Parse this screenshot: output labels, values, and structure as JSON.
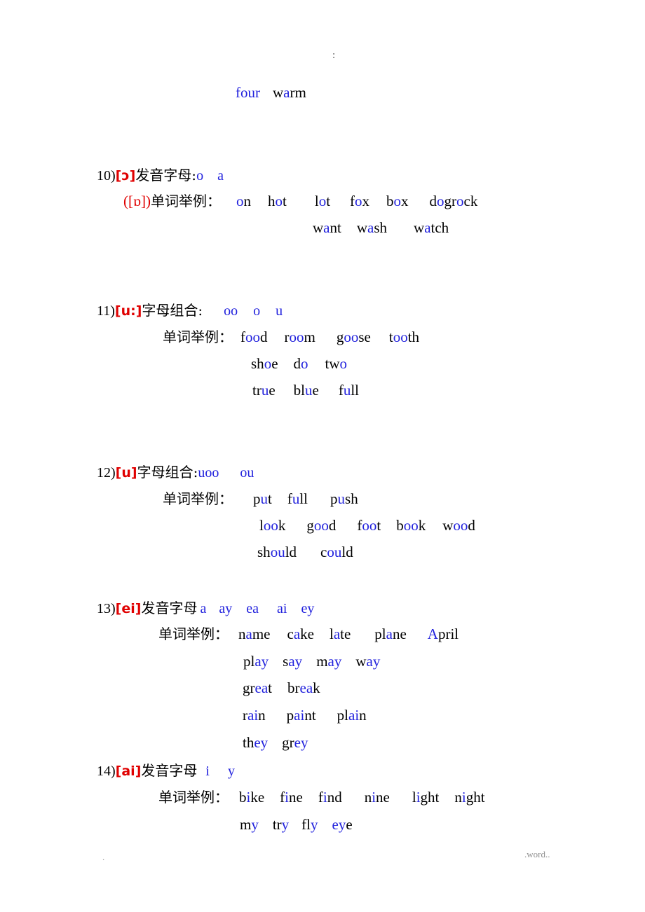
{
  "document": {
    "type": "english-phonetics-study-notes",
    "language": "zh-CN",
    "stray_mark": ":",
    "footer_left": ".",
    "footer_right": ".word..",
    "colors": {
      "ipa_red": "#e00000",
      "letter_blue": "#2222dd",
      "body_black": "#000000",
      "footer_gray": "#9a9a9a",
      "background": "#ffffff"
    },
    "labels": {
      "pronunciation_letter": "发音字母",
      "letter_combination": "字母组合",
      "word_examples": "单词举例"
    }
  },
  "continuation": {
    "words": [
      {
        "pre": "f",
        "hl": "ou",
        "post": "r",
        "all_blue": true
      },
      {
        "pre": "w",
        "hl": "a",
        "post": "rm",
        "all_blue": false
      }
    ]
  },
  "sections": [
    {
      "number": "10)",
      "ipa": "[ɔ]",
      "label": "发音字母:",
      "letters": [
        "o",
        "a"
      ],
      "sub_ipa": "([ɒ])",
      "examples_label": "单词举例：",
      "rows": [
        {
          "words": [
            {
              "pre": "",
              "hl": "o",
              "post": "n"
            },
            {
              "pre": "h",
              "hl": "o",
              "post": "t"
            },
            {
              "pre": "l",
              "hl": "o",
              "post": "t"
            },
            {
              "pre": "f",
              "hl": "o",
              "post": "x"
            },
            {
              "pre": "b",
              "hl": "o",
              "post": "x"
            },
            {
              "pre": "d",
              "hl": "o",
              "post": "g"
            },
            {
              "pre": "r",
              "hl": "o",
              "post": "ck"
            }
          ]
        },
        {
          "words": [
            {
              "pre": "w",
              "hl": "a",
              "post": "nt"
            },
            {
              "pre": "w",
              "hl": "a",
              "post": "sh"
            },
            {
              "pre": "w",
              "hl": "a",
              "post": "tch"
            }
          ]
        }
      ]
    },
    {
      "number": "11)",
      "ipa": "[u:]",
      "label": "字母组合:",
      "letters": [
        "oo",
        "o",
        "u"
      ],
      "examples_label": "单词举例：",
      "rows": [
        {
          "words": [
            {
              "pre": "f",
              "hl": "oo",
              "post": "d"
            },
            {
              "pre": "r",
              "hl": "oo",
              "post": "m"
            },
            {
              "pre": "g",
              "hl": "oo",
              "post": "se"
            },
            {
              "pre": "t",
              "hl": "oo",
              "post": "th"
            }
          ]
        },
        {
          "words": [
            {
              "pre": "sh",
              "hl": "o",
              "post": "e"
            },
            {
              "pre": "d",
              "hl": "o",
              "post": ""
            },
            {
              "pre": "tw",
              "hl": "o",
              "post": ""
            }
          ]
        },
        {
          "words": [
            {
              "pre": "tr",
              "hl": "u",
              "post": "e"
            },
            {
              "pre": "bl",
              "hl": "u",
              "post": "e"
            },
            {
              "pre": "f",
              "hl": "u",
              "post": "ll"
            }
          ]
        }
      ]
    },
    {
      "number": "12)",
      "ipa": "[u]",
      "label": "字母组合:",
      "letters": [
        "uoo",
        "ou"
      ],
      "examples_label": "单词举例：",
      "rows": [
        {
          "words": [
            {
              "pre": "p",
              "hl": "u",
              "post": "t"
            },
            {
              "pre": "f",
              "hl": "u",
              "post": "ll"
            },
            {
              "pre": "p",
              "hl": "u",
              "post": "sh"
            }
          ]
        },
        {
          "words": [
            {
              "pre": "l",
              "hl": "oo",
              "post": "k"
            },
            {
              "pre": "g",
              "hl": "oo",
              "post": "d"
            },
            {
              "pre": "f",
              "hl": "oo",
              "post": "t"
            },
            {
              "pre": "b",
              "hl": "oo",
              "post": "k"
            },
            {
              "pre": "w",
              "hl": "oo",
              "post": "d"
            }
          ]
        },
        {
          "words": [
            {
              "pre": "sh",
              "hl": "ou",
              "post": "ld"
            },
            {
              "pre": "c",
              "hl": "ou",
              "post": "ld"
            }
          ]
        }
      ]
    },
    {
      "number": "13)",
      "ipa": "[ei]",
      "label": "发音字母",
      "letters": [
        "a",
        "ay",
        "ea",
        "ai",
        "ey"
      ],
      "examples_label": "单词举例：",
      "rows": [
        {
          "words": [
            {
              "pre": "n",
              "hl": "a",
              "post": "me"
            },
            {
              "pre": "c",
              "hl": "a",
              "post": "ke"
            },
            {
              "pre": "l",
              "hl": "a",
              "post": "te"
            },
            {
              "pre": "pl",
              "hl": "a",
              "post": "ne"
            },
            {
              "pre": "",
              "hl": "A",
              "post": "pril"
            }
          ]
        },
        {
          "words": [
            {
              "pre": "pl",
              "hl": "ay",
              "post": ""
            },
            {
              "pre": "s",
              "hl": "ay",
              "post": ""
            },
            {
              "pre": "m",
              "hl": "ay",
              "post": ""
            },
            {
              "pre": "w",
              "hl": "ay",
              "post": ""
            }
          ]
        },
        {
          "words": [
            {
              "pre": "gr",
              "hl": "ea",
              "post": "t"
            },
            {
              "pre": "br",
              "hl": "ea",
              "post": "k"
            }
          ]
        },
        {
          "words": [
            {
              "pre": "r",
              "hl": "ai",
              "post": "n"
            },
            {
              "pre": "p",
              "hl": "ai",
              "post": "nt"
            },
            {
              "pre": "pl",
              "hl": "ai",
              "post": "n"
            }
          ]
        },
        {
          "words": [
            {
              "pre": "th",
              "hl": "ey",
              "post": ""
            },
            {
              "pre": "gr",
              "hl": "ey",
              "post": ""
            }
          ]
        }
      ]
    },
    {
      "number": "14)",
      "ipa": "[ai]",
      "label": "发音字母",
      "letters": [
        "i",
        "y"
      ],
      "examples_label": "单词举例：",
      "rows": [
        {
          "words": [
            {
              "pre": "b",
              "hl": "i",
              "post": "ke"
            },
            {
              "pre": "f",
              "hl": "i",
              "post": "ne"
            },
            {
              "pre": "f",
              "hl": "i",
              "post": "nd"
            },
            {
              "pre": "n",
              "hl": "i",
              "post": "ne"
            },
            {
              "pre": "l",
              "hl": "i",
              "post": "ght"
            },
            {
              "pre": "n",
              "hl": "i",
              "post": "ght"
            }
          ]
        },
        {
          "words": [
            {
              "pre": "m",
              "hl": "y",
              "post": ""
            },
            {
              "pre": "tr",
              "hl": "y",
              "post": ""
            },
            {
              "pre": "fl",
              "hl": "y",
              "post": ""
            },
            {
              "pre": "",
              "hl": "ey",
              "post": "e"
            }
          ]
        }
      ]
    }
  ]
}
